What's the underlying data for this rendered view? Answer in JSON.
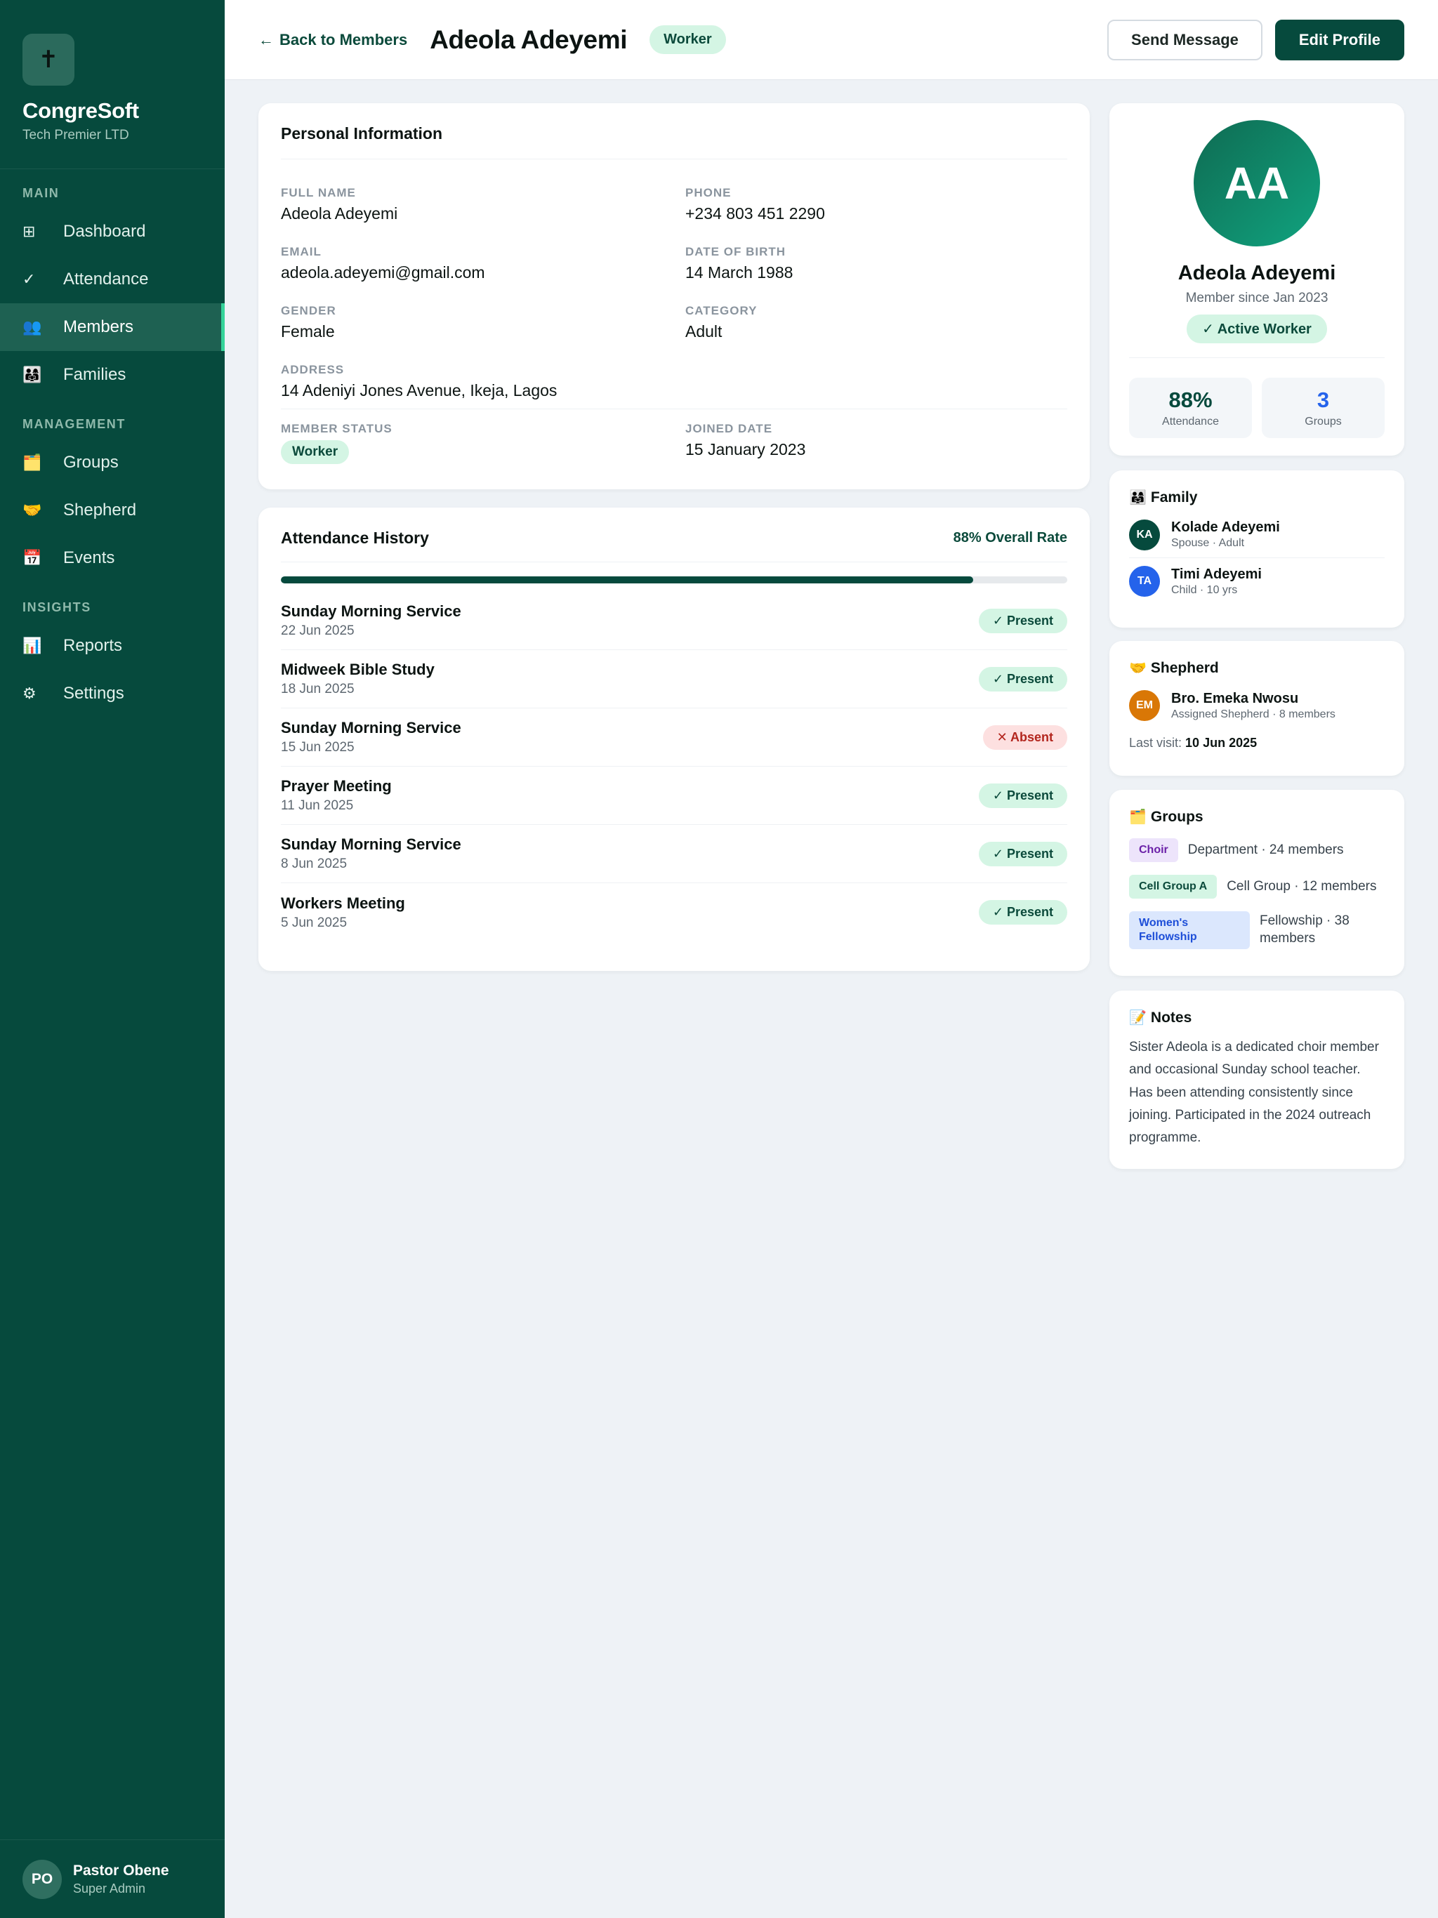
{
  "sidebar": {
    "brand_icon": "✝",
    "brand_name": "CongreSoft",
    "brand_sub": "Tech Premier LTD",
    "sections": {
      "main": "MAIN",
      "management": "MANAGEMENT",
      "insights": "INSIGHTS"
    },
    "items": {
      "dashboard": {
        "icon": "⊞",
        "label": "Dashboard"
      },
      "attendance": {
        "icon": "✓",
        "label": "Attendance"
      },
      "members": {
        "icon": "👥",
        "label": "Members"
      },
      "families": {
        "icon": "👨‍👩‍👧",
        "label": "Families"
      },
      "groups": {
        "icon": "🗂️",
        "label": "Groups"
      },
      "shepherd": {
        "icon": "🤝",
        "label": "Shepherd"
      },
      "events": {
        "icon": "📅",
        "label": "Events"
      },
      "reports": {
        "icon": "📊",
        "label": "Reports"
      },
      "settings": {
        "icon": "⚙",
        "label": "Settings"
      }
    },
    "user": {
      "initials": "PO",
      "name": "Pastor Obene",
      "role": "Super Admin"
    }
  },
  "header": {
    "back_arrow": "←",
    "back_label": "Back to Members",
    "title": "Adeola Adeyemi",
    "badge": "Worker",
    "send_message": "Send Message",
    "edit_profile": "Edit Profile"
  },
  "personal": {
    "title": "Personal Information",
    "full_name_label": "FULL NAME",
    "full_name": "Adeola Adeyemi",
    "phone_label": "PHONE",
    "phone": "+234 803 451 2290",
    "email_label": "EMAIL",
    "email": "adeola.adeyemi@gmail.com",
    "dob_label": "DATE OF BIRTH",
    "dob": "14 March 1988",
    "gender_label": "GENDER",
    "gender": "Female",
    "category_label": "CATEGORY",
    "category": "Adult",
    "address_label": "ADDRESS",
    "address": "14 Adeniyi Jones Avenue, Ikeja, Lagos",
    "status_label": "MEMBER STATUS",
    "status": "Worker",
    "joined_label": "JOINED DATE",
    "joined": "15 January 2023"
  },
  "attendance": {
    "title": "Attendance History",
    "rate_label": "88% Overall Rate",
    "rate_value": 0.88,
    "rows": [
      {
        "name": "Sunday Morning Service",
        "date": "22 Jun 2025",
        "status": "✓ Present",
        "present": true
      },
      {
        "name": "Midweek Bible Study",
        "date": "18 Jun 2025",
        "status": "✓ Present",
        "present": true
      },
      {
        "name": "Sunday Morning Service",
        "date": "15 Jun 2025",
        "status": "✕ Absent",
        "present": false
      },
      {
        "name": "Prayer Meeting",
        "date": "11 Jun 2025",
        "status": "✓ Present",
        "present": true
      },
      {
        "name": "Sunday Morning Service",
        "date": "8 Jun 2025",
        "status": "✓ Present",
        "present": true
      },
      {
        "name": "Workers Meeting",
        "date": "5 Jun 2025",
        "status": "✓ Present",
        "present": true
      }
    ]
  },
  "profile": {
    "initials": "AA",
    "name": "Adeola Adeyemi",
    "since": "Member since Jan 2023",
    "badge": "✓ Active Worker",
    "stats": {
      "attendance_value": "88%",
      "attendance_label": "Attendance",
      "groups_value": "3",
      "groups_label": "Groups"
    }
  },
  "family": {
    "icon": "👨‍👩‍👧",
    "title": "Family",
    "members": [
      {
        "initials": "KA",
        "name": "Kolade Adeyemi",
        "meta": "Spouse · Adult",
        "color": "#064a3d"
      },
      {
        "initials": "TA",
        "name": "Timi Adeyemi",
        "meta": "Child · 10 yrs",
        "color": "#2563eb"
      }
    ]
  },
  "shepherd": {
    "icon": "🤝",
    "title": "Shepherd",
    "initials": "EM",
    "name": "Bro. Emeka Nwosu",
    "meta": "Assigned Shepherd · 8 members",
    "last_visit_label": "Last visit:",
    "last_visit": "10 Jun 2025",
    "color": "#d97706"
  },
  "groups": {
    "icon": "🗂️",
    "title": "Groups",
    "items": [
      {
        "tag": "Choir",
        "desc": "Department · 24 members",
        "bg": "#ede4fb",
        "fg": "#6b21a8"
      },
      {
        "tag": "Cell Group A",
        "desc": "Cell Group · 12 members",
        "bg": "#d4f5e4",
        "fg": "#0b4a3b"
      },
      {
        "tag": "Women's Fellowship",
        "desc": "Fellowship · 38 members",
        "bg": "#dbe7fd",
        "fg": "#1d4ed8"
      }
    ]
  },
  "notes": {
    "icon": "📝",
    "title": "Notes",
    "text": "Sister Adeola is a dedicated choir member and occasional Sunday school teacher. Has been attending consistently since joining. Participated in the 2024 outreach programme."
  },
  "colors": {
    "sidebar": "#064a3d",
    "accent": "#34d399",
    "primary": "#064a3d",
    "present_bg": "#d4f5e4",
    "absent_bg": "#fde0e0",
    "groups_stat": "#2563eb",
    "attendance_stat": "#064a3d"
  }
}
